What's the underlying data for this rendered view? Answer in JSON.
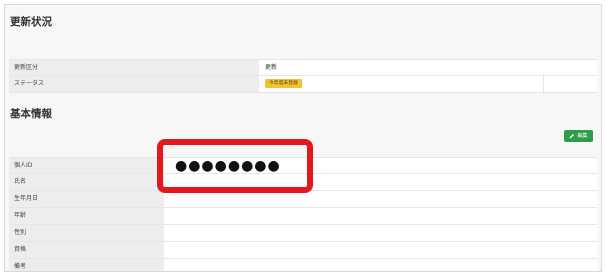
{
  "update_status": {
    "title": "更新状況",
    "rows": [
      {
        "label": "更新区分",
        "value": "更新"
      },
      {
        "label": "ステータス",
        "badge": "今年度未登録"
      }
    ]
  },
  "basic_info": {
    "title": "基本情報",
    "edit_label": "編集",
    "masked_id": "●●●●●●●●",
    "rows": [
      {
        "label": "個人ID",
        "value": ""
      },
      {
        "label": "氏名",
        "value": ""
      },
      {
        "label": "生年月日",
        "value": ""
      },
      {
        "label": "年齢",
        "value": ""
      },
      {
        "label": "性別",
        "value": ""
      },
      {
        "label": "資格",
        "value": ""
      },
      {
        "label": "備考",
        "value": ""
      }
    ]
  },
  "colors": {
    "badge": "#f2c230",
    "edit_button": "#2e9c49",
    "highlight": "#e4171c"
  }
}
